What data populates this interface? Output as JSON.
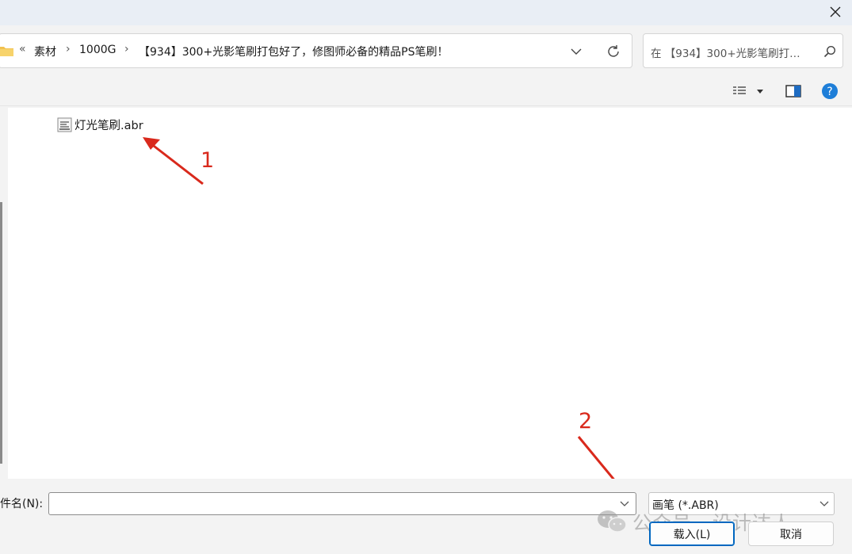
{
  "titlebar": {
    "close_icon": "close-icon"
  },
  "address": {
    "overflow_glyph": "«",
    "crumbs": [
      "素材",
      "1000G",
      "【934】300+光影笔刷打包好了，修图师必备的精品PS笔刷！"
    ],
    "separator": "›"
  },
  "search": {
    "placeholder": "在 【934】300+光影笔刷打…"
  },
  "toolbar": {
    "view_icon": "details-view-icon",
    "preview_icon": "preview-pane-icon",
    "help_icon": "help-icon"
  },
  "files": [
    {
      "name": "灯光笔刷.abr",
      "icon": "abr-file-icon"
    }
  ],
  "annotations": {
    "one": "1",
    "two": "2",
    "color": "#d9291c"
  },
  "bottom": {
    "filename_label": "件名(N):",
    "filename_value": "",
    "filetype": "画笔 (*.ABR)",
    "load_label": "载入(L)",
    "cancel_label": "取消"
  },
  "watermark": "公众号 · 设计达人",
  "colors": {
    "accent": "#0067c0",
    "help": "#1e7ed8",
    "folder": "#f2c14e"
  }
}
